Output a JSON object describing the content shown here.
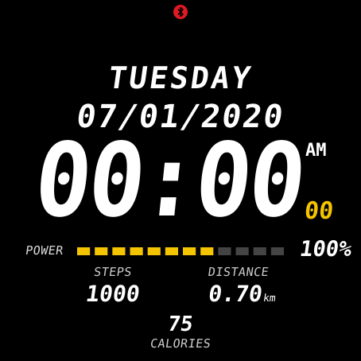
{
  "status": {
    "bluetooth_icon": "bluetooth-icon",
    "bluetooth_color": "#e01a22"
  },
  "date": {
    "day": "TUESDAY",
    "date": "07/01/2020"
  },
  "time": {
    "hhmm": "00:00",
    "ampm": "AM",
    "seconds": "00"
  },
  "battery": {
    "label": "POWER",
    "percent_text": "100%",
    "segments_total": 12,
    "segments_filled": 8,
    "fill_color": "#f5c400",
    "empty_color": "#444444"
  },
  "steps": {
    "label": "STEPS",
    "value": "1000"
  },
  "distance": {
    "label": "DISTANCE",
    "value": "0.70",
    "unit": "km"
  },
  "calories": {
    "value": "75",
    "label": "CALORIES"
  },
  "colors": {
    "accent": "#f5c400",
    "text": "#ffffff",
    "background": "#000000"
  }
}
